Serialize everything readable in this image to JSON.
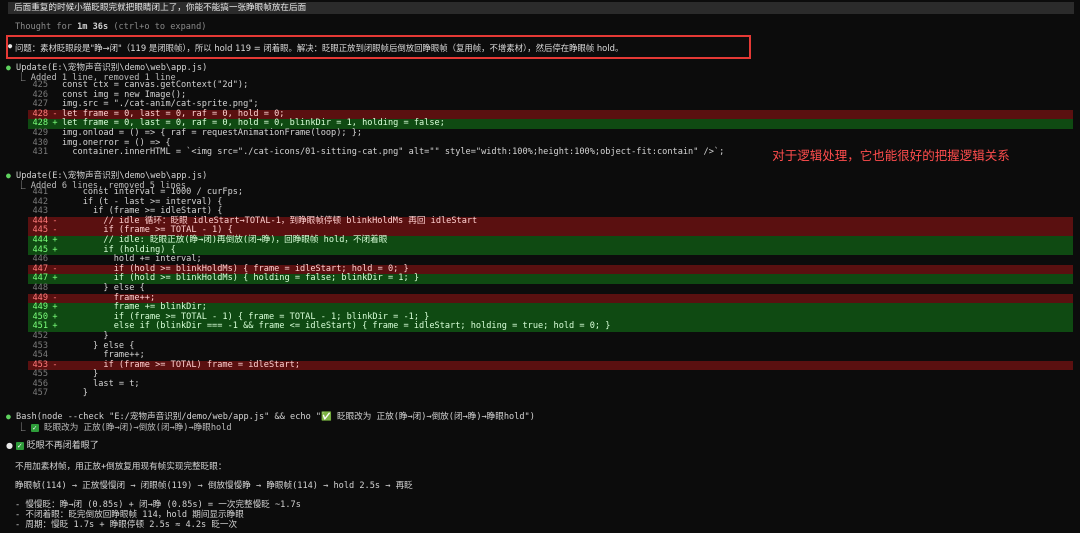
{
  "topbar": "后面重复的时候小猫眨眼完就把眼睛闭上了，你能不能搞一张睁眼帧放在后面",
  "thought": {
    "prefix": "Thought for ",
    "time": "1m 36s",
    "suffix": " (ctrl+o to expand)"
  },
  "issue": "问题：素材眨眼段是\"睁→闭\"（119 是闭眼帧），所以 hold 119 = 闭着眼。解决：眨眼正放到闭眼帧后倒放回睁眼帧（复用帧，不增素材），然后停在睁眼帧 hold。",
  "update1": {
    "title": "Update(E:\\宠物声音识别\\demo\\web\\app.js)",
    "summary": "Added 1 line, removed 1 line",
    "lines": [
      {
        "ln": "425",
        "t": "ctx",
        "code": "const ctx = canvas.getContext(\"2d\");"
      },
      {
        "ln": "426",
        "t": "ctx",
        "code": "const img = new Image();"
      },
      {
        "ln": "427",
        "t": "ctx",
        "code": "img.src = \"./cat-anim/cat-sprite.png\";"
      },
      {
        "ln": "428",
        "t": "del",
        "code": "let frame = 0, last = 0, raf = 0, hold = 0;"
      },
      {
        "ln": "428",
        "t": "add",
        "code": "let frame = 0, last = 0, raf = 0, hold = 0, blinkDir = 1, holding = false;"
      },
      {
        "ln": "429",
        "t": "ctx",
        "code": "img.onload = () => { raf = requestAnimationFrame(loop); };"
      },
      {
        "ln": "430",
        "t": "ctx",
        "code": "img.onerror = () => {"
      },
      {
        "ln": "431",
        "t": "ctx",
        "code": "  container.innerHTML = `<img src=\"./cat-icons/01-sitting-cat.png\" alt=\"\" style=\"width:100%;height:100%;object-fit:contain\" />`;"
      }
    ]
  },
  "update2": {
    "title": "Update(E:\\宠物声音识别\\demo\\web\\app.js)",
    "summary": "Added 6 lines, removed 5 lines",
    "lines": [
      {
        "ln": "441",
        "t": "ctx",
        "code": "    const interval = 1000 / curFps;"
      },
      {
        "ln": "442",
        "t": "ctx",
        "code": "    if (t - last >= interval) {"
      },
      {
        "ln": "443",
        "t": "ctx",
        "code": "      if (frame >= idleStart) {"
      },
      {
        "ln": "444",
        "t": "del",
        "code": "        // idle 循环：眨眼 idleStart→TOTAL-1，到睁眼帧停顿 blinkHoldMs 再回 idleStart"
      },
      {
        "ln": "445",
        "t": "del",
        "code": "        if (frame >= TOTAL - 1) {"
      },
      {
        "ln": "444",
        "t": "add",
        "code": "        // idle: 眨眼正放(睁→闭)再倒放(闭→睁)，回睁眼帧 hold，不闭着眼"
      },
      {
        "ln": "445",
        "t": "add",
        "code": "        if (holding) {"
      },
      {
        "ln": "446",
        "t": "ctx",
        "code": "          hold += interval;"
      },
      {
        "ln": "447",
        "t": "del",
        "code": "          if (hold >= blinkHoldMs) { frame = idleStart; hold = 0; }"
      },
      {
        "ln": "447",
        "t": "add",
        "code": "          if (hold >= blinkHoldMs) { holding = false; blinkDir = 1; }"
      },
      {
        "ln": "448",
        "t": "ctx",
        "code": "        } else {"
      },
      {
        "ln": "449",
        "t": "del",
        "code": "          frame++;"
      },
      {
        "ln": "449",
        "t": "add",
        "code": "          frame += blinkDir;"
      },
      {
        "ln": "450",
        "t": "add",
        "code": "          if (frame >= TOTAL - 1) { frame = TOTAL - 1; blinkDir = -1; }"
      },
      {
        "ln": "451",
        "t": "add",
        "code": "          else if (blinkDir === -1 && frame <= idleStart) { frame = idleStart; holding = true; hold = 0; }"
      },
      {
        "ln": "452",
        "t": "ctx",
        "code": "        }"
      },
      {
        "ln": "453",
        "t": "ctx",
        "code": "      } else {"
      },
      {
        "ln": "454",
        "t": "ctx",
        "code": "        frame++;"
      },
      {
        "ln": "453",
        "t": "del",
        "code": "        if (frame >= TOTAL) frame = idleStart;"
      },
      {
        "ln": "455",
        "t": "ctx",
        "code": "      }"
      },
      {
        "ln": "456",
        "t": "ctx",
        "code": "      last = t;"
      },
      {
        "ln": "457",
        "t": "ctx",
        "code": "    }"
      }
    ]
  },
  "bash": {
    "title": "Bash(node --check \"E:/宠物声音识别/demo/web/app.js\" && echo \"✅ 眨眼改为 正放(睁→闭)→倒放(闭→睁)→睁眼hold\")",
    "result": "眨眼改为 正放(睁→闭)→倒放(闭→睁)→睁眼hold"
  },
  "done": "眨眼不再闭着眼了",
  "explain": [
    "不用加素材帧，用正放+倒放复用现有帧实现完整眨眼：",
    "睁眼帧(114) → 正放慢慢闭 → 闭眼帧(119) → 倒放慢慢睁 → 睁眼帧(114) → hold 2.5s → 再眨",
    "- 慢慢眨：睁→闭 (0.85s) + 闭→睁 (0.85s) = 一次完整慢眨 ~1.7s",
    "- 不闭着眼：眨完倒放回睁眼帧 114，hold 期间显示睁眼",
    "- 周期：慢眨 1.7s + 睁眼停顿 2.5s ≈ 4.2s 眨一次"
  ],
  "annotation": "对于逻辑处理，它也能很好的把握逻辑关系",
  "colors": {
    "accent_red": "#e53935",
    "diff_add": "#0f4a12",
    "diff_del": "#5a1010",
    "ok_green": "#5fd35f"
  }
}
